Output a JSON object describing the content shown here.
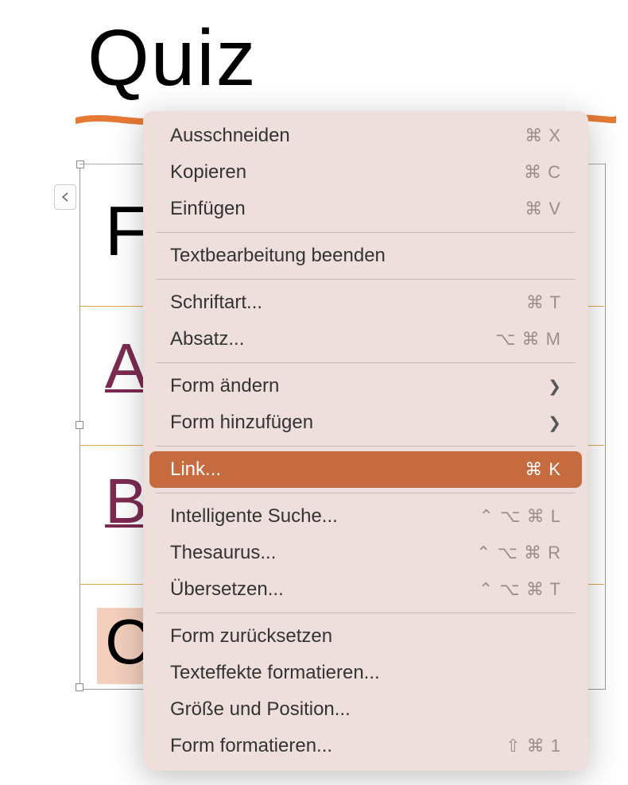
{
  "title": "Quiz",
  "letters": {
    "f": "F",
    "a": "A",
    "b": "B",
    "c": "C"
  },
  "menu": {
    "cut": {
      "label": "Ausschneiden",
      "sc": "⌘ X"
    },
    "copy": {
      "label": "Kopieren",
      "sc": "⌘ C"
    },
    "paste": {
      "label": "Einfügen",
      "sc": "⌘ V"
    },
    "endtext": {
      "label": "Textbearbeitung beenden"
    },
    "font": {
      "label": "Schriftart...",
      "sc": "⌘ T"
    },
    "para": {
      "label": "Absatz...",
      "sc": "⌥ ⌘ M"
    },
    "changeshape": {
      "label": "Form ändern"
    },
    "addshape": {
      "label": "Form hinzufügen"
    },
    "link": {
      "label": "Link...",
      "sc": "⌘ K"
    },
    "smart": {
      "label": "Intelligente Suche...",
      "sc": "⌃ ⌥ ⌘ L"
    },
    "thes": {
      "label": "Thesaurus...",
      "sc": "⌃ ⌥ ⌘ R"
    },
    "trans": {
      "label": "Übersetzen...",
      "sc": "⌃ ⌥ ⌘ T"
    },
    "reset": {
      "label": "Form zurücksetzen"
    },
    "tfx": {
      "label": "Texteffekte formatieren..."
    },
    "size": {
      "label": "Größe und Position..."
    },
    "fmt": {
      "label": "Form formatieren...",
      "sc": "⇧ ⌘ 1"
    }
  }
}
